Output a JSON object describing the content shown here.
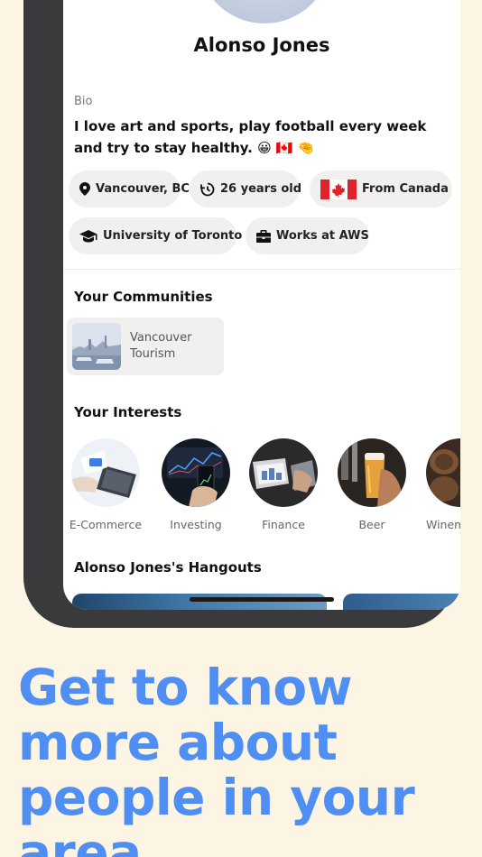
{
  "profile": {
    "name": "Alonso Jones",
    "bio_label": "Bio",
    "bio_text": "I love art and sports, play football every week and try to stay healthy. 😀 🇨🇦 🤏"
  },
  "chips": [
    {
      "label": "Vancouver, BC",
      "icon": "location-pin-icon"
    },
    {
      "label": "26 years old",
      "icon": "history-clock-icon"
    },
    {
      "label": "From Canada",
      "icon": "canada-flag-icon"
    },
    {
      "label": "University of Toronto",
      "icon": "graduation-cap-icon"
    },
    {
      "label": "Works at AWS",
      "icon": "briefcase-icon"
    }
  ],
  "communities": {
    "title": "Your Communities",
    "items": [
      {
        "name": "Vancouver Tourism"
      }
    ]
  },
  "interests": {
    "title": "Your Interests",
    "items": [
      {
        "label": "E-Commerce"
      },
      {
        "label": "Investing"
      },
      {
        "label": "Finance"
      },
      {
        "label": "Beer"
      },
      {
        "label": "Winem"
      }
    ]
  },
  "hangouts": {
    "title": "Alonso Jones's Hangouts"
  },
  "tagline": "Get to know more about people in your area",
  "colors": {
    "background": "#fcf5e3",
    "accent": "#4f8ef2",
    "phone_frame": "#3a3a3c",
    "chip_bg": "#f1f0ef"
  }
}
